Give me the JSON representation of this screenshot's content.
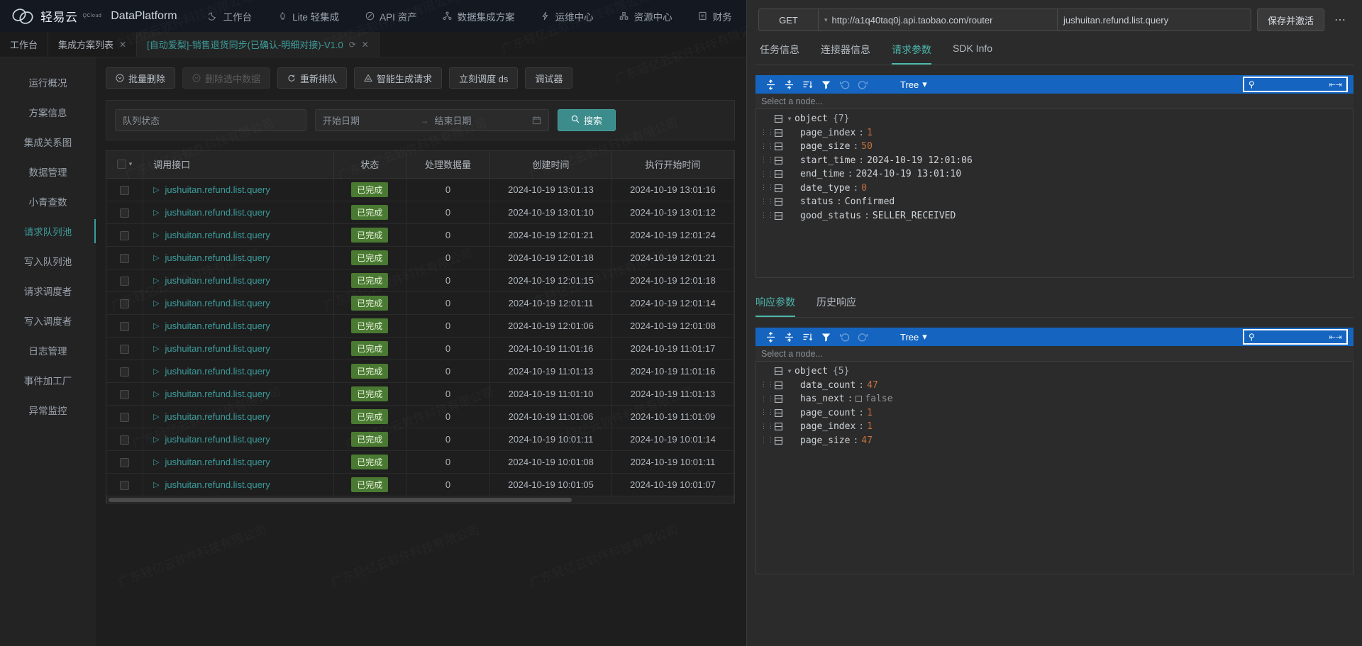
{
  "topnav": {
    "brand_cn": "轻易云",
    "brand_sub": "QCloud",
    "brand_name": "DataPlatform",
    "items": [
      {
        "label": "工作台",
        "icon": "moon-icon"
      },
      {
        "label": "Lite 轻集成",
        "icon": "rocket-icon"
      },
      {
        "label": "API 资产",
        "icon": "compass-icon"
      },
      {
        "label": "数据集成方案",
        "icon": "sitemap-icon"
      },
      {
        "label": "运维中心",
        "icon": "lightning-icon"
      },
      {
        "label": "资源中心",
        "icon": "nodes-icon"
      },
      {
        "label": "财务",
        "icon": "calculator-icon"
      }
    ]
  },
  "tabstrip": {
    "tabs": [
      {
        "label": "工作台",
        "closable": false,
        "active": false
      },
      {
        "label": "集成方案列表",
        "closable": true,
        "active": false
      },
      {
        "label": "[自动爱梨]-销售退货同步(已确认-明细对接)-V1.0",
        "closable": true,
        "refresh": true,
        "active": true
      }
    ],
    "close_glyph": "✕",
    "refresh_glyph": "⟳"
  },
  "sidebar": {
    "items": [
      {
        "label": "运行概况",
        "active": false
      },
      {
        "label": "方案信息",
        "active": false
      },
      {
        "label": "集成关系图",
        "active": false
      },
      {
        "label": "数据管理",
        "active": false
      },
      {
        "label": "小青查数",
        "active": false
      },
      {
        "label": "请求队列池",
        "active": true
      },
      {
        "label": "写入队列池",
        "active": false
      },
      {
        "label": "请求调度者",
        "active": false
      },
      {
        "label": "写入调度者",
        "active": false
      },
      {
        "label": "日志管理",
        "active": false
      },
      {
        "label": "事件加工厂",
        "active": false
      },
      {
        "label": "异常监控",
        "active": false
      }
    ]
  },
  "toolbar": {
    "buttons": [
      {
        "label": "批量删除",
        "icon": "circle-down-icon",
        "disabled": false
      },
      {
        "label": "删除选中数据",
        "icon": "circle-down-icon",
        "disabled": true
      },
      {
        "label": "重新排队",
        "icon": "refresh-icon",
        "disabled": false
      },
      {
        "label": "智能生成请求",
        "icon": "triangle-icon",
        "disabled": false
      },
      {
        "label": "立刻调度 ds",
        "icon": "",
        "disabled": false
      },
      {
        "label": "调试器",
        "icon": "",
        "disabled": false
      }
    ]
  },
  "filterbar": {
    "queue_state_placeholder": "队列状态",
    "queue_state_value": "",
    "start_date_placeholder": "开始日期",
    "end_date_placeholder": "结束日期",
    "range_arrow": "→",
    "calendar_icon": "calendar-icon",
    "search_label": "搜索",
    "search_icon": "search-icon"
  },
  "table": {
    "columns": [
      "调用接口",
      "状态",
      "处理数据量",
      "创建时间",
      "执行开始时间"
    ],
    "rows": [
      {
        "api": "jushuitan.refund.list.query",
        "status": "已完成",
        "count": "0",
        "created": "2024-10-19 13:01:13",
        "started": "2024-10-19 13:01:16"
      },
      {
        "api": "jushuitan.refund.list.query",
        "status": "已完成",
        "count": "0",
        "created": "2024-10-19 13:01:10",
        "started": "2024-10-19 13:01:12"
      },
      {
        "api": "jushuitan.refund.list.query",
        "status": "已完成",
        "count": "0",
        "created": "2024-10-19 12:01:21",
        "started": "2024-10-19 12:01:24"
      },
      {
        "api": "jushuitan.refund.list.query",
        "status": "已完成",
        "count": "0",
        "created": "2024-10-19 12:01:18",
        "started": "2024-10-19 12:01:21"
      },
      {
        "api": "jushuitan.refund.list.query",
        "status": "已完成",
        "count": "0",
        "created": "2024-10-19 12:01:15",
        "started": "2024-10-19 12:01:18"
      },
      {
        "api": "jushuitan.refund.list.query",
        "status": "已完成",
        "count": "0",
        "created": "2024-10-19 12:01:11",
        "started": "2024-10-19 12:01:14"
      },
      {
        "api": "jushuitan.refund.list.query",
        "status": "已完成",
        "count": "0",
        "created": "2024-10-19 12:01:06",
        "started": "2024-10-19 12:01:08"
      },
      {
        "api": "jushuitan.refund.list.query",
        "status": "已完成",
        "count": "0",
        "created": "2024-10-19 11:01:16",
        "started": "2024-10-19 11:01:17"
      },
      {
        "api": "jushuitan.refund.list.query",
        "status": "已完成",
        "count": "0",
        "created": "2024-10-19 11:01:13",
        "started": "2024-10-19 11:01:16"
      },
      {
        "api": "jushuitan.refund.list.query",
        "status": "已完成",
        "count": "0",
        "created": "2024-10-19 11:01:10",
        "started": "2024-10-19 11:01:13"
      },
      {
        "api": "jushuitan.refund.list.query",
        "status": "已完成",
        "count": "0",
        "created": "2024-10-19 11:01:06",
        "started": "2024-10-19 11:01:09"
      },
      {
        "api": "jushuitan.refund.list.query",
        "status": "已完成",
        "count": "0",
        "created": "2024-10-19 10:01:11",
        "started": "2024-10-19 10:01:14"
      },
      {
        "api": "jushuitan.refund.list.query",
        "status": "已完成",
        "count": "0",
        "created": "2024-10-19 10:01:08",
        "started": "2024-10-19 10:01:11"
      },
      {
        "api": "jushuitan.refund.list.query",
        "status": "已完成",
        "count": "0",
        "created": "2024-10-19 10:01:05",
        "started": "2024-10-19 10:01:07"
      }
    ]
  },
  "watermark": {
    "text": "广东轻亿云软件科技有限公司"
  },
  "request": {
    "method": "GET",
    "url": "http://a1q40taq0j.api.taobao.com/router",
    "api_name": "jushuitan.refund.list.query",
    "save_label": "保存并激活",
    "more_glyph": "⋯"
  },
  "right_tabs": {
    "items": [
      {
        "label": "任务信息",
        "active": false
      },
      {
        "label": "连接器信息",
        "active": false
      },
      {
        "label": "请求参数",
        "active": true
      },
      {
        "label": "SDK Info",
        "active": false
      }
    ]
  },
  "json_toolbar": {
    "mode_label": "Tree",
    "mode_caret": "▾",
    "path_placeholder": "Select a node...",
    "icons": [
      "expand-all-icon",
      "collapse-all-icon",
      "sort-icon",
      "filter-icon",
      "undo-icon",
      "redo-icon"
    ],
    "search_icon": "search-icon",
    "accent": "#1565c0"
  },
  "request_json": {
    "root_label": "object",
    "root_count": "{7}",
    "rows": [
      {
        "key": "page_index",
        "value": "1",
        "type": "num"
      },
      {
        "key": "page_size",
        "value": "50",
        "type": "num"
      },
      {
        "key": "start_time",
        "value": "2024-10-19 12:01:06",
        "type": "str"
      },
      {
        "key": "end_time",
        "value": "2024-10-19 13:01:10",
        "type": "str"
      },
      {
        "key": "date_type",
        "value": "0",
        "type": "num"
      },
      {
        "key": "status",
        "value": "Confirmed",
        "type": "str"
      },
      {
        "key": "good_status",
        "value": "SELLER_RECEIVED",
        "type": "str"
      }
    ]
  },
  "response_tabs": {
    "items": [
      {
        "label": "响应参数",
        "active": true
      },
      {
        "label": "历史响应",
        "active": false
      }
    ]
  },
  "response_json": {
    "root_label": "object",
    "root_count": "{5}",
    "rows": [
      {
        "key": "data_count",
        "value": "47",
        "type": "num"
      },
      {
        "key": "has_next",
        "value": "false",
        "type": "bool"
      },
      {
        "key": "page_count",
        "value": "1",
        "type": "num"
      },
      {
        "key": "page_index",
        "value": "1",
        "type": "num"
      },
      {
        "key": "page_size",
        "value": "47",
        "type": "num"
      }
    ]
  }
}
